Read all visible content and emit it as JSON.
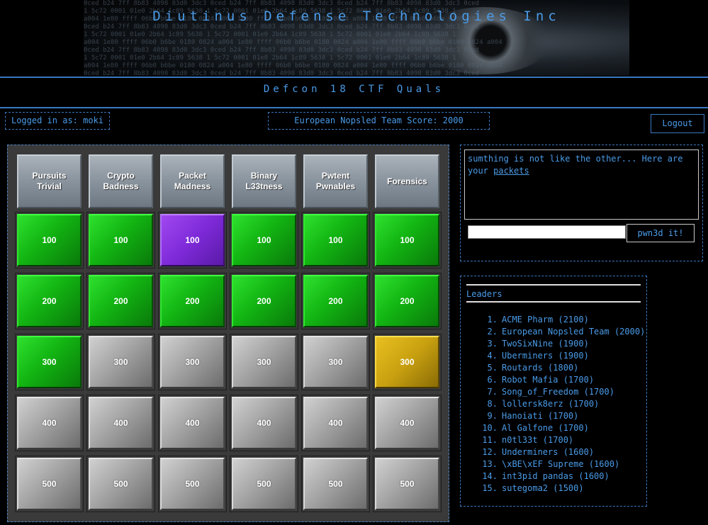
{
  "site": {
    "title": "Diutinus Defense Technologies Inc",
    "subtitle": "Defcon 18 CTF Quals"
  },
  "status": {
    "logged_in": "Logged in as: moki",
    "team_score": "European Nopsled Team Score: 2000",
    "logout_label": "Logout"
  },
  "board": {
    "categories": [
      "Pursuits\nTrivial",
      "Crypto\nBadness",
      "Packet\nMadness",
      "Binary\nL33tness",
      "Pwtent\nPwnables",
      "Forensics"
    ],
    "category_lines": [
      [
        "Pursuits",
        "Trivial"
      ],
      [
        "Crypto",
        "Badness"
      ],
      [
        "Packet",
        "Madness"
      ],
      [
        "Binary",
        "L33tness"
      ],
      [
        "Pwtent",
        "Pwnables"
      ],
      [
        "Forensics"
      ]
    ],
    "point_values": [
      "100",
      "200",
      "300",
      "400",
      "500"
    ],
    "states": [
      [
        "solved",
        "solved",
        "selected",
        "solved",
        "solved",
        "solved"
      ],
      [
        "solved",
        "solved",
        "solved",
        "solved",
        "solved",
        "solved"
      ],
      [
        "solved",
        "open",
        "open",
        "open",
        "open",
        "highlighted"
      ],
      [
        "open",
        "open",
        "open",
        "open",
        "open",
        "open"
      ],
      [
        "open",
        "open",
        "open",
        "open",
        "open",
        "open"
      ]
    ]
  },
  "colors": {
    "solved": "#12b412",
    "open": "#a4a4a4",
    "selected": "#7e2ad8",
    "highlighted": "#c8a010",
    "accent": "#4a9be8"
  },
  "question": {
    "text_before": "sumthing is not like the other... Here are your ",
    "link_text": "packets",
    "submit_label": "pwn3d it!"
  },
  "leaders": {
    "title": "Leaders",
    "entries": [
      "ACME Pharm (2100)",
      "European Nopsled Team (2000)",
      "TwoSixNine (1900)",
      "Uberminers (1900)",
      "Routards (1800)",
      "Robot Mafia (1700)",
      "Song_of_Freedom (1700)",
      "lollersk8erz (1700)",
      "Hanoiati (1700)",
      "Al Galfone (1700)",
      "n0tl33t (1700)",
      "Underminers (1600)",
      "\\xBE\\xEF Supreme (1600)",
      "int3pid pandas (1600)",
      "sutegoma2 (1500)"
    ]
  }
}
